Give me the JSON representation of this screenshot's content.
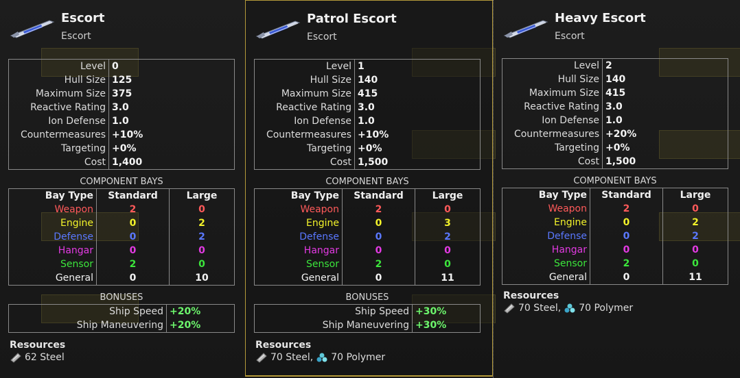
{
  "colors": {
    "weapon": "#ff5a5a",
    "engine": "#f2f22a",
    "defense": "#5a78ff",
    "hangar": "#e23ae2",
    "sensor": "#3ce63c",
    "general": "#f2f2f2",
    "bonus": "#6cf56c",
    "panel_border": "#b59a3a"
  },
  "labels": {
    "level": "Level",
    "hull_size": "Hull Size",
    "maximum_size": "Maximum Size",
    "reactive_rating": "Reactive Rating",
    "ion_defense": "Ion Defense",
    "countermeasures": "Countermeasures",
    "targeting": "Targeting",
    "cost": "Cost",
    "component_bays": "COMPONENT BAYS",
    "bay_type": "Bay Type",
    "standard": "Standard",
    "large": "Large",
    "bonuses": "BONUSES",
    "resources": "Resources"
  },
  "panels": [
    {
      "name": "Escort",
      "class": "Escort",
      "icon": "escort-ship-icon",
      "stats": {
        "level": "0",
        "hull_size": "125",
        "maximum_size": "375",
        "reactive_rating": "3.0",
        "ion_defense": "1.0",
        "countermeasures": "+10%",
        "targeting": "+0%",
        "cost": "1,400"
      },
      "bays": [
        {
          "type": "Weapon",
          "standard": "2",
          "large": "0",
          "color_key": "weapon"
        },
        {
          "type": "Engine",
          "standard": "0",
          "large": "2",
          "color_key": "engine"
        },
        {
          "type": "Defense",
          "standard": "0",
          "large": "2",
          "color_key": "defense"
        },
        {
          "type": "Hangar",
          "standard": "0",
          "large": "0",
          "color_key": "hangar"
        },
        {
          "type": "Sensor",
          "standard": "2",
          "large": "0",
          "color_key": "sensor"
        },
        {
          "type": "General",
          "standard": "0",
          "large": "10",
          "color_key": "general"
        }
      ],
      "bonuses": [
        {
          "label": "Ship Speed",
          "value": "+20%"
        },
        {
          "label": "Ship Maneuvering",
          "value": "+20%"
        }
      ],
      "resources": [
        {
          "icon": "steel-icon",
          "text": "62 Steel"
        }
      ]
    },
    {
      "name": "Patrol Escort",
      "class": "Escort",
      "icon": "escort-ship-icon",
      "stats": {
        "level": "1",
        "hull_size": "140",
        "maximum_size": "415",
        "reactive_rating": "3.0",
        "ion_defense": "1.0",
        "countermeasures": "+10%",
        "targeting": "+0%",
        "cost": "1,500"
      },
      "bays": [
        {
          "type": "Weapon",
          "standard": "2",
          "large": "0",
          "color_key": "weapon"
        },
        {
          "type": "Engine",
          "standard": "0",
          "large": "3",
          "color_key": "engine"
        },
        {
          "type": "Defense",
          "standard": "0",
          "large": "2",
          "color_key": "defense"
        },
        {
          "type": "Hangar",
          "standard": "0",
          "large": "0",
          "color_key": "hangar"
        },
        {
          "type": "Sensor",
          "standard": "2",
          "large": "0",
          "color_key": "sensor"
        },
        {
          "type": "General",
          "standard": "0",
          "large": "11",
          "color_key": "general"
        }
      ],
      "bonuses": [
        {
          "label": "Ship Speed",
          "value": "+30%"
        },
        {
          "label": "Ship Maneuvering",
          "value": "+30%"
        }
      ],
      "resources": [
        {
          "icon": "steel-icon",
          "text": "70 Steel,"
        },
        {
          "icon": "polymer-icon",
          "text": "70 Polymer"
        }
      ]
    },
    {
      "name": "Heavy Escort",
      "class": "Escort",
      "icon": "escort-ship-icon",
      "stats": {
        "level": "2",
        "hull_size": "140",
        "maximum_size": "415",
        "reactive_rating": "3.0",
        "ion_defense": "1.0",
        "countermeasures": "+20%",
        "targeting": "+0%",
        "cost": "1,500"
      },
      "bays": [
        {
          "type": "Weapon",
          "standard": "2",
          "large": "0",
          "color_key": "weapon"
        },
        {
          "type": "Engine",
          "standard": "0",
          "large": "2",
          "color_key": "engine"
        },
        {
          "type": "Defense",
          "standard": "0",
          "large": "2",
          "color_key": "defense"
        },
        {
          "type": "Hangar",
          "standard": "0",
          "large": "0",
          "color_key": "hangar"
        },
        {
          "type": "Sensor",
          "standard": "2",
          "large": "0",
          "color_key": "sensor"
        },
        {
          "type": "General",
          "standard": "0",
          "large": "11",
          "color_key": "general"
        }
      ],
      "bonuses": [],
      "resources": [
        {
          "icon": "steel-icon",
          "text": "70 Steel,"
        },
        {
          "icon": "polymer-icon",
          "text": "70 Polymer"
        }
      ]
    }
  ]
}
